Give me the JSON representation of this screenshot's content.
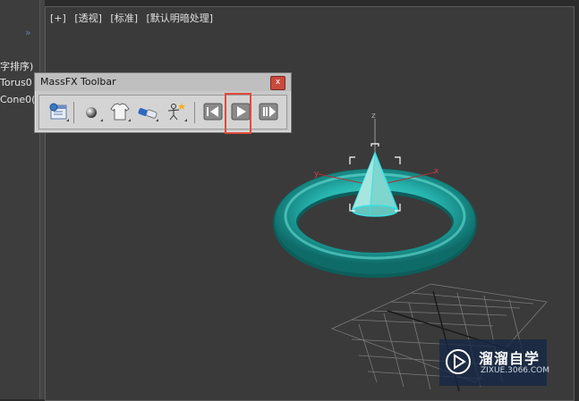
{
  "left_panel": {
    "chevron": "»",
    "items": [
      "字排序)",
      "Torus0",
      "Cone0("
    ]
  },
  "viewport": {
    "labels": [
      "[+]",
      "[透视]",
      "[标准]",
      "[默认明暗处理]"
    ],
    "axes": {
      "z": "z",
      "x": "x",
      "y": "y"
    }
  },
  "massfx_toolbar": {
    "title": "MassFX Toolbar",
    "close_glyph": "x",
    "buttons": [
      {
        "name": "world-parameters-button",
        "icon": "world-parameters-icon"
      },
      {
        "name": "rigid-body-button",
        "icon": "sphere-icon"
      },
      {
        "name": "cloth-button",
        "icon": "shirt-icon"
      },
      {
        "name": "constraint-button",
        "icon": "constraint-icon"
      },
      {
        "name": "ragdoll-button",
        "icon": "ragdoll-icon"
      },
      {
        "name": "reset-simulation-button",
        "icon": "reset-icon"
      },
      {
        "name": "start-simulation-button",
        "icon": "play-icon"
      },
      {
        "name": "step-simulation-button",
        "icon": "step-icon"
      }
    ],
    "highlighted_button": "start-simulation-button",
    "highlight_color": "#e24a3c"
  },
  "scene": {
    "torus_color": "#26b3ae",
    "cone_color": "#7fd6cf"
  },
  "watermark": {
    "brand": "溜溜自学",
    "url": "ZIXUE.3066.COM"
  }
}
